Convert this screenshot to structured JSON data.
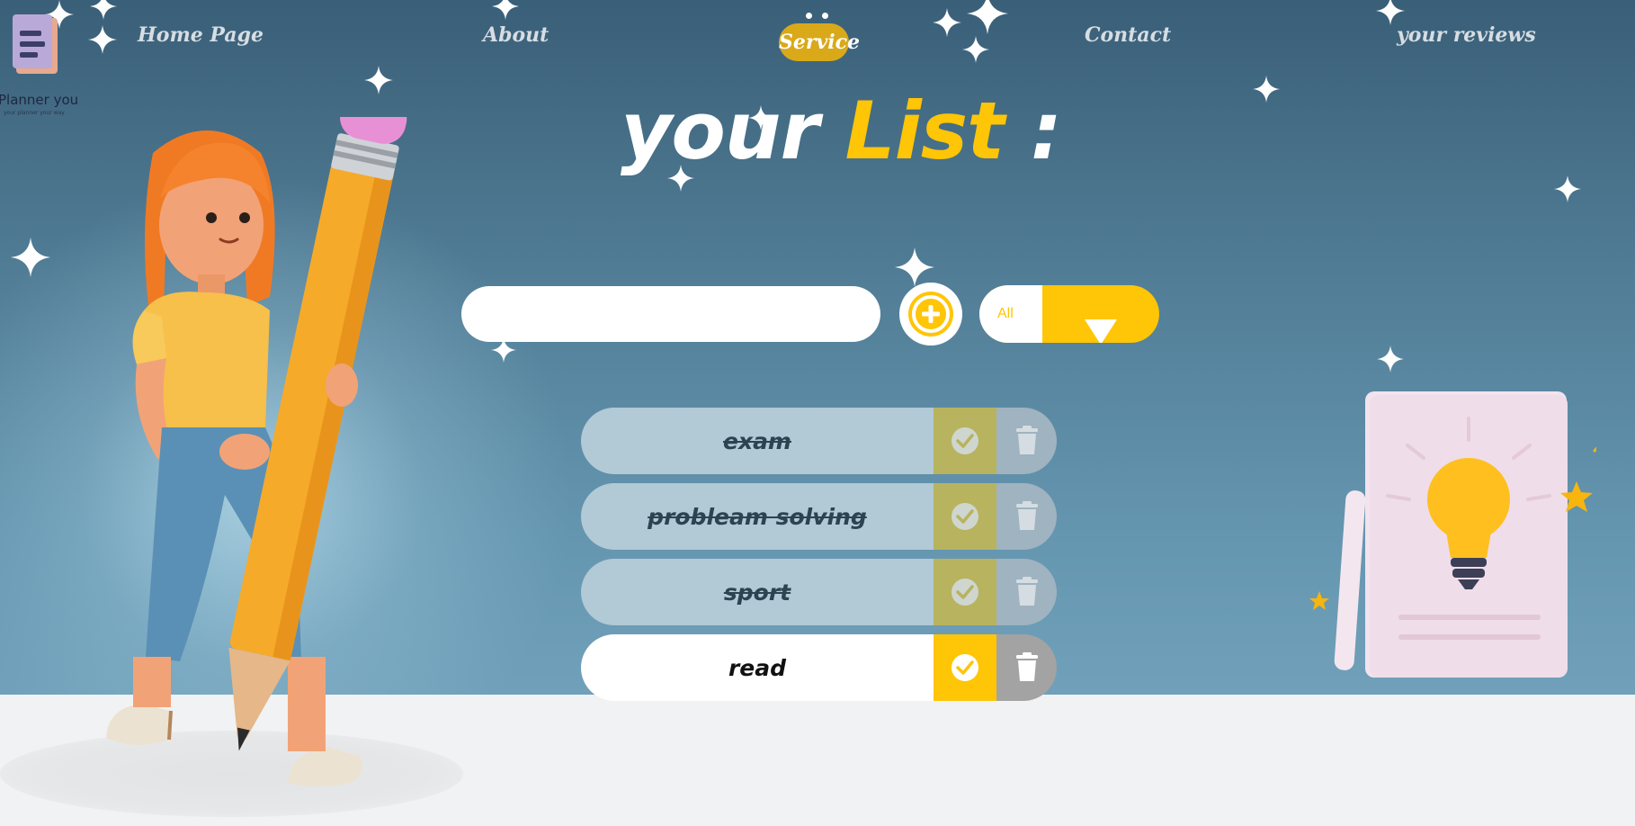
{
  "brand": {
    "name": "Planner you",
    "tagline": "your planner your way"
  },
  "nav": {
    "items": [
      {
        "label": "Home Page"
      },
      {
        "label": "About"
      },
      {
        "label": "Service"
      },
      {
        "label": "Contact"
      },
      {
        "label": "your reviews"
      }
    ],
    "active": "Service"
  },
  "heading": {
    "part1": "your",
    "part2": "List",
    "part3": ":"
  },
  "controls": {
    "input_value": "",
    "input_placeholder": "",
    "add_icon": "plus-circle-icon",
    "filter_selected": "All",
    "filter_icon": "triangle-down-icon"
  },
  "todos": [
    {
      "text": "exam",
      "completed": true
    },
    {
      "text": "probleam solving",
      "completed": true
    },
    {
      "text": "sport",
      "completed": true
    },
    {
      "text": "read",
      "completed": false
    }
  ],
  "icons": {
    "check": "check-icon",
    "delete": "trash-icon"
  },
  "colors": {
    "accent": "#ffc507",
    "nav_active": "#d9a91a",
    "background_top": "#3a5f78",
    "floor": "#f1f2f3"
  },
  "illustrations": [
    "girl-with-pencil",
    "lightbulb-card"
  ]
}
